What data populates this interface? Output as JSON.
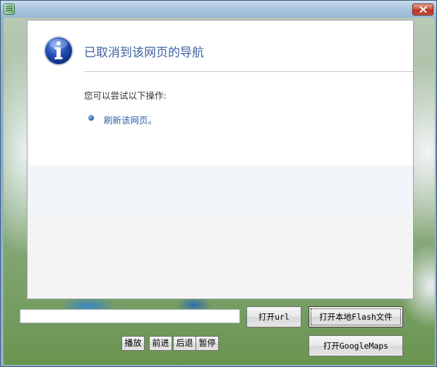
{
  "window": {
    "title": ""
  },
  "page": {
    "title": "已取消到该网页的导航",
    "suggestion": "您可以尝试以下操作:",
    "refresh_link": "刷新该网页。"
  },
  "controls": {
    "url_value": "",
    "open_url_label": "打开url",
    "open_flash_label": "打开本地Flash文件",
    "open_maps_label": "打开GoogleMaps",
    "play_label": "播放",
    "forward_label": "前进",
    "back_label": "后退",
    "pause_label": "暂停"
  },
  "icons": {
    "app": "app-logo-icon",
    "close": "close-icon",
    "info": "info-icon",
    "bullet": "bullet-icon"
  },
  "colors": {
    "title_blue": "#3c5fa0",
    "link_blue": "#2b5fa8",
    "close_red": "#c8503a"
  }
}
